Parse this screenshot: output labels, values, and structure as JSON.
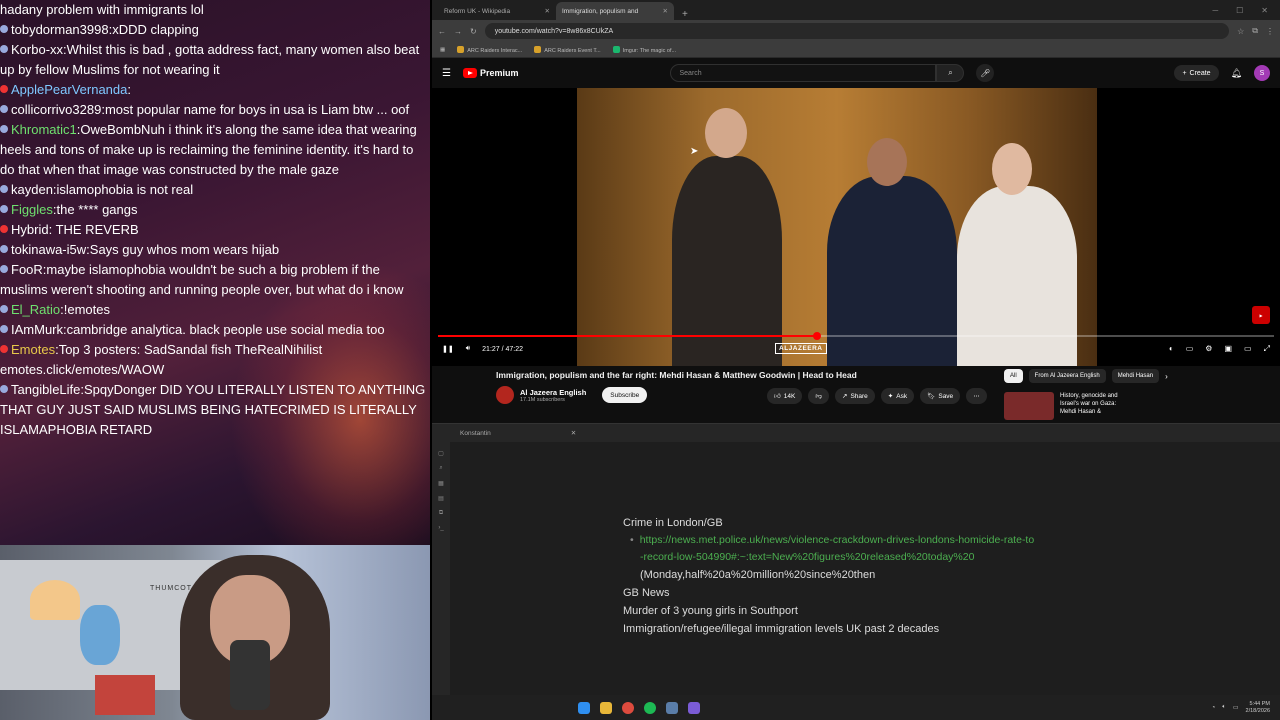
{
  "chat": {
    "lines": [
      {
        "user": "",
        "text": "hadany problem with immigrants lol",
        "color": "#ffffff"
      },
      {
        "user": "tobydorman3998",
        "text": ":xDDD clapping",
        "color": "#ffffff"
      },
      {
        "user": "Korbo-xx",
        "text": ":Whilst this is bad , gotta address fact, many women also beat up by fellow Muslims for not wearing it",
        "color": "#ffffff"
      },
      {
        "user": "ApplePearVernanda",
        "text": ":",
        "color": "#7fc8ff"
      },
      {
        "user": "collicorrivo3289",
        "text": ":most popular name for boys in usa is Liam btw ... oof",
        "color": "#ffffff"
      },
      {
        "user": "Khromatic1",
        "text": ":OweBombNuh i think it's along the same idea that wearing heels and tons of make up is reclaiming the feminine identity. it's hard to do that when that image was constructed by the male gaze",
        "color": "#6fe06f"
      },
      {
        "user": "kayden",
        "text": ":islamophobia is not real",
        "color": "#ffffff"
      },
      {
        "user": "Figgles",
        "text": ":the **** gangs",
        "color": "#6fe06f"
      },
      {
        "user": "Hybrid",
        "text": ": THE REVERB",
        "color": "#ffffff"
      },
      {
        "user": "tokinawa-i5w",
        "text": ":Says guy whos mom wears hijab",
        "color": "#ffffff"
      },
      {
        "user": "FooR",
        "text": ":maybe islamophobia wouldn't be such a big problem if the muslims weren't shooting and running people over, but what do i know",
        "color": "#ffffff"
      },
      {
        "user": "El_Ratio",
        "text": ":!emotes",
        "color": "#6fe06f"
      },
      {
        "user": "IAmMurk",
        "text": ":cambridge analytica. black people use social media too",
        "color": "#ffffff"
      },
      {
        "user": "Emotes",
        "text": ":Top 3 posters: SadSandal fish TheRealNihilist emotes.click/emotes/WAOW",
        "color": "#e8c94a"
      },
      {
        "user": "TangibleLife",
        "text": ":SpqyDonger DID YOU LITERALLY LISTEN TO ANYTHING THAT GUY JUST SAID MUSLIMS BEING HATECRIMED IS LITERALLY ISLAMAPHOBIA RETARD",
        "color": "#ffffff"
      }
    ]
  },
  "webcam": {
    "sign": "THUMCOT SUBSCRIBERS"
  },
  "browser": {
    "tabs": [
      {
        "label": "Reform UK - Wikipedia",
        "active": false
      },
      {
        "label": "Immigration, populism and",
        "active": true
      }
    ],
    "url": "youtube.com/watch?v=8w86x8CUkZA",
    "bookmarks": [
      "ARC Raiders Interac...",
      "ARC Raiders Event T...",
      "Imgur: The magic of..."
    ]
  },
  "youtube": {
    "logo": "Premium",
    "search_placeholder": "Search",
    "create_label": "Create",
    "avatar_letter": "S",
    "watermark": "ALJAZEERA",
    "time": "21:27 / 47:22",
    "progress": 0.453,
    "title": "Immigration, populism and the far right: Mehdi Hasan & Matthew Goodwin | Head to Head",
    "channel": "Al Jazeera English",
    "subscribers": "17.1M subscribers",
    "subscribe_label": "Subscribe",
    "likes": "14K",
    "share_label": "Share",
    "ask_label": "Ask",
    "save_label": "Save",
    "chips": [
      "All",
      "From Al Jazeera English",
      "Mehdi Hasan"
    ],
    "rec_title": "History, genocide and Israel's war on Gaza: Mehdi Hasan &"
  },
  "notes": {
    "tab_title": "Konstantin",
    "heading": "Crime in London/GB",
    "link_line1": "https://news.met.police.uk/news/violence-crackdown-drives-londons-homicide-rate-to",
    "link_line2": "-record-low-504990#:~:text=New%20figures%20released%20today%20",
    "link_cont": "(Monday,half%20a%20million%20since%20then",
    "line2": "GB News",
    "line3": "Murder of 3 young girls in Southport",
    "line4": "Immigration/refugee/illegal immigration levels UK past 2 decades"
  },
  "taskbar": {
    "time": "5:44 PM",
    "date": "2/18/2026"
  }
}
